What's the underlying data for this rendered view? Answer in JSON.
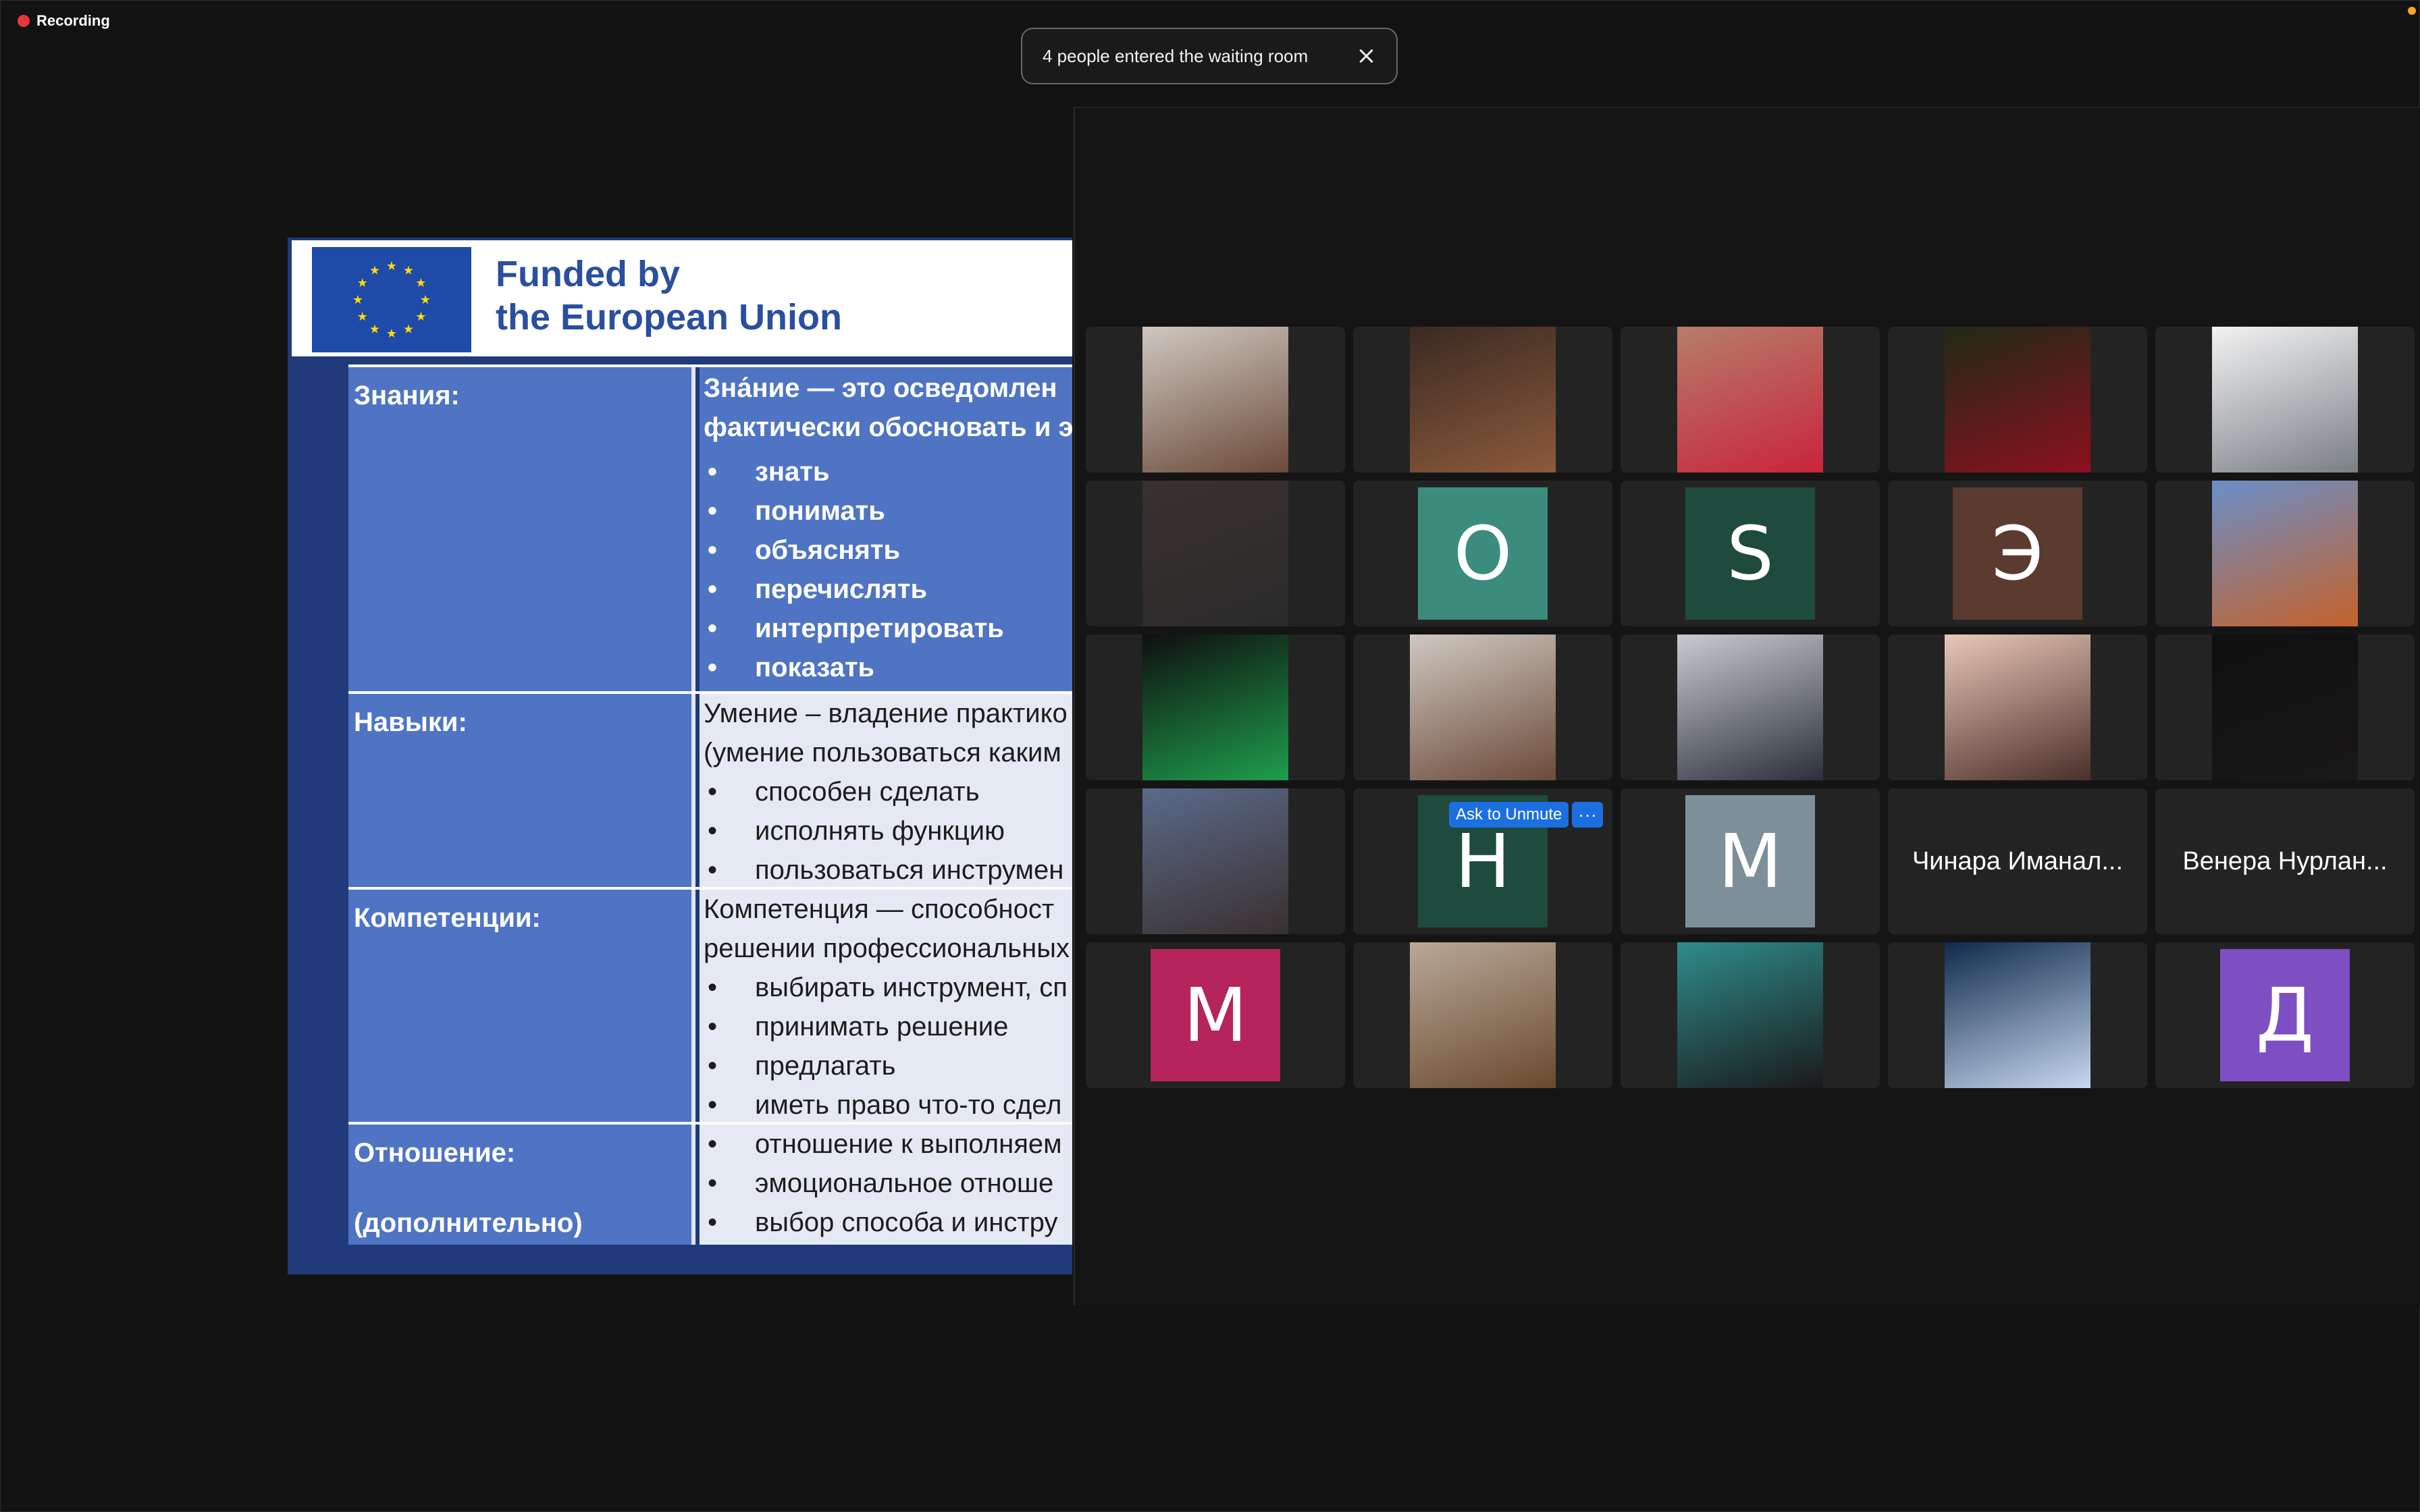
{
  "recording": {
    "label": "Recording"
  },
  "toast": {
    "message": "4 people entered the waiting room"
  },
  "slide": {
    "header_line1": "Funded by",
    "header_line2": "the European Union",
    "rows": [
      {
        "label": "Знания:",
        "text_lines": [
          "Зна́ние — это осведомлен",
          "фактически обосновать и эл"
        ],
        "bullets": [
          "знать",
          "понимать",
          "объяснять",
          "перечислять",
          "интерпретировать",
          "показать"
        ]
      },
      {
        "label": "Навыки:",
        "text_lines": [
          "Умение – владение практико",
          "(умение пользоваться каким"
        ],
        "bullets": [
          "способен сделать",
          "исполнять функцию",
          "пользоваться инструмен"
        ]
      },
      {
        "label": "Компетенции:",
        "text_lines": [
          "Компетенция — способност",
          "решении профессиональных"
        ],
        "bullets": [
          "выбирать инструмент, сп",
          "принимать решение",
          "предлагать",
          "иметь право что-то сдел"
        ]
      },
      {
        "label": "Отношение:",
        "label2": "(дополнительно)",
        "text_lines": [],
        "bullets": [
          "отношение к выполняем",
          "эмоциональное отноше",
          "выбор способа и инстру"
        ]
      }
    ]
  },
  "participants": {
    "tiles": [
      {
        "type": "photo",
        "icon": "woman-portrait"
      },
      {
        "type": "photo",
        "icon": "woman-headscarf-portrait"
      },
      {
        "type": "photo",
        "icon": "woman-red-dress-portrait"
      },
      {
        "type": "photo",
        "icon": "red-rose-image"
      },
      {
        "type": "photo",
        "icon": "man-portrait"
      },
      {
        "type": "photo",
        "icon": "woman-glasses-portrait"
      },
      {
        "type": "initial",
        "initial": "O",
        "color": "#3b8c7c"
      },
      {
        "type": "initial",
        "initial": "S",
        "color": "#1f4a3e"
      },
      {
        "type": "initial",
        "initial": "Э",
        "color": "#5b3a30"
      },
      {
        "type": "photo",
        "icon": "desert-landscape-image"
      },
      {
        "type": "photo",
        "icon": "npo-kg-logo"
      },
      {
        "type": "photo",
        "icon": "woman-portrait"
      },
      {
        "type": "photo",
        "icon": "man-suit-portrait"
      },
      {
        "type": "photo",
        "icon": "woman-selfie-portrait"
      },
      {
        "type": "photo",
        "icon": "dark-video-feed"
      },
      {
        "type": "photo",
        "icon": "two-men-photo"
      },
      {
        "type": "initial",
        "initial": "Н",
        "color": "#1f4a3e",
        "ask_unmute": "Ask to Unmute",
        "more": "···"
      },
      {
        "type": "initial",
        "initial": "M",
        "color": "#7d8f99"
      },
      {
        "type": "name",
        "name": "Чинара Иманал..."
      },
      {
        "type": "name",
        "name": "Венера Нурлан..."
      },
      {
        "type": "initial",
        "initial": "M",
        "color": "#b5245a"
      },
      {
        "type": "photo",
        "icon": "woman-mirror-selfie"
      },
      {
        "type": "photo",
        "icon": "computer-illustration"
      },
      {
        "type": "photo",
        "icon": "digital-network-image"
      },
      {
        "type": "initial",
        "initial": "Д",
        "color": "#7e4fc2"
      }
    ]
  }
}
